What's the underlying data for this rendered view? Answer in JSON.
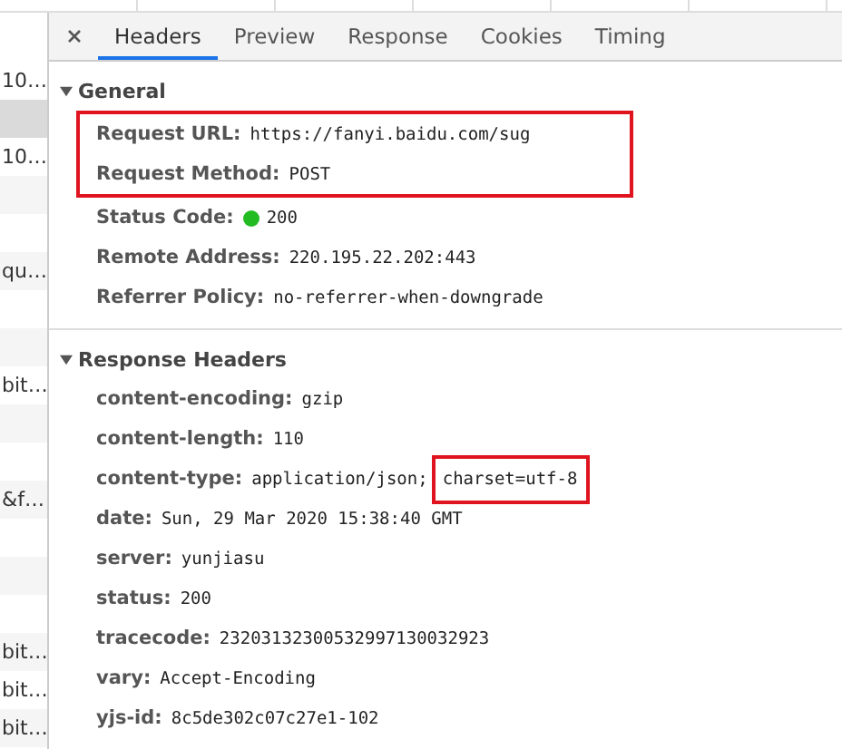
{
  "request_list": {
    "rows": [
      {
        "text": "10…",
        "selected": false
      },
      {
        "selected": true
      },
      {
        "text": "10…",
        "selected": false
      },
      {
        "selected": false
      },
      {
        "selected": false
      },
      {
        "text": "qu…",
        "selected": false
      },
      {
        "selected": false
      },
      {
        "selected": false
      },
      {
        "text": "bit…",
        "selected": false
      },
      {
        "selected": false
      },
      {
        "selected": false
      },
      {
        "text": "&f…",
        "selected": false
      },
      {
        "selected": false
      },
      {
        "selected": false
      },
      {
        "selected": false
      },
      {
        "text": "bit…",
        "selected": false
      },
      {
        "text": "bit…",
        "selected": false
      },
      {
        "text": "bit…",
        "selected": false
      }
    ]
  },
  "tabs": [
    {
      "label": "Headers",
      "selected": true
    },
    {
      "label": "Preview",
      "selected": false
    },
    {
      "label": "Response",
      "selected": false
    },
    {
      "label": "Cookies",
      "selected": false
    },
    {
      "label": "Timing",
      "selected": false
    }
  ],
  "sections": [
    {
      "title": "General",
      "expanded": true,
      "items": [
        {
          "name": "Request URL:",
          "value": "https://fanyi.baidu.com/sug",
          "highlighted": true
        },
        {
          "name": "Request Method:",
          "value": "POST",
          "highlighted": true
        },
        {
          "name": "Status Code:",
          "value": "200",
          "color": "#22bb22",
          "highlighted": false
        },
        {
          "name": "Remote Address:",
          "value": "220.195.22.202:443",
          "highlighted": false
        },
        {
          "name": "Referrer Policy:",
          "value": "no-referrer-when-downgrade",
          "highlighted": false
        }
      ]
    },
    {
      "title": "Response Headers",
      "expanded": true,
      "items": [
        {
          "name": "content-encoding:",
          "value": "gzip",
          "highlighted": false
        },
        {
          "name": "content-length:",
          "value": "110",
          "highlighted": false
        },
        {
          "name": "content-type:",
          "value": "application/json;",
          "highlighted_value": "charset=utf-8",
          "highlighted": false
        },
        {
          "name": "date:",
          "value": "Sun, 29 Mar 2020 15:38:40 GMT",
          "highlighted": false
        },
        {
          "name": "server:",
          "value": "yunjiasu",
          "highlighted": false
        },
        {
          "name": "status:",
          "value": "200",
          "highlighted": false
        },
        {
          "name": "tracecode:",
          "value": "23203132300532997130032923",
          "highlighted": false
        },
        {
          "name": "vary:",
          "value": "Accept-Encoding",
          "highlighted": false
        },
        {
          "name": "yjs-id:",
          "value": "8c5de302c07c27e1-102",
          "highlighted": false
        }
      ]
    }
  ]
}
